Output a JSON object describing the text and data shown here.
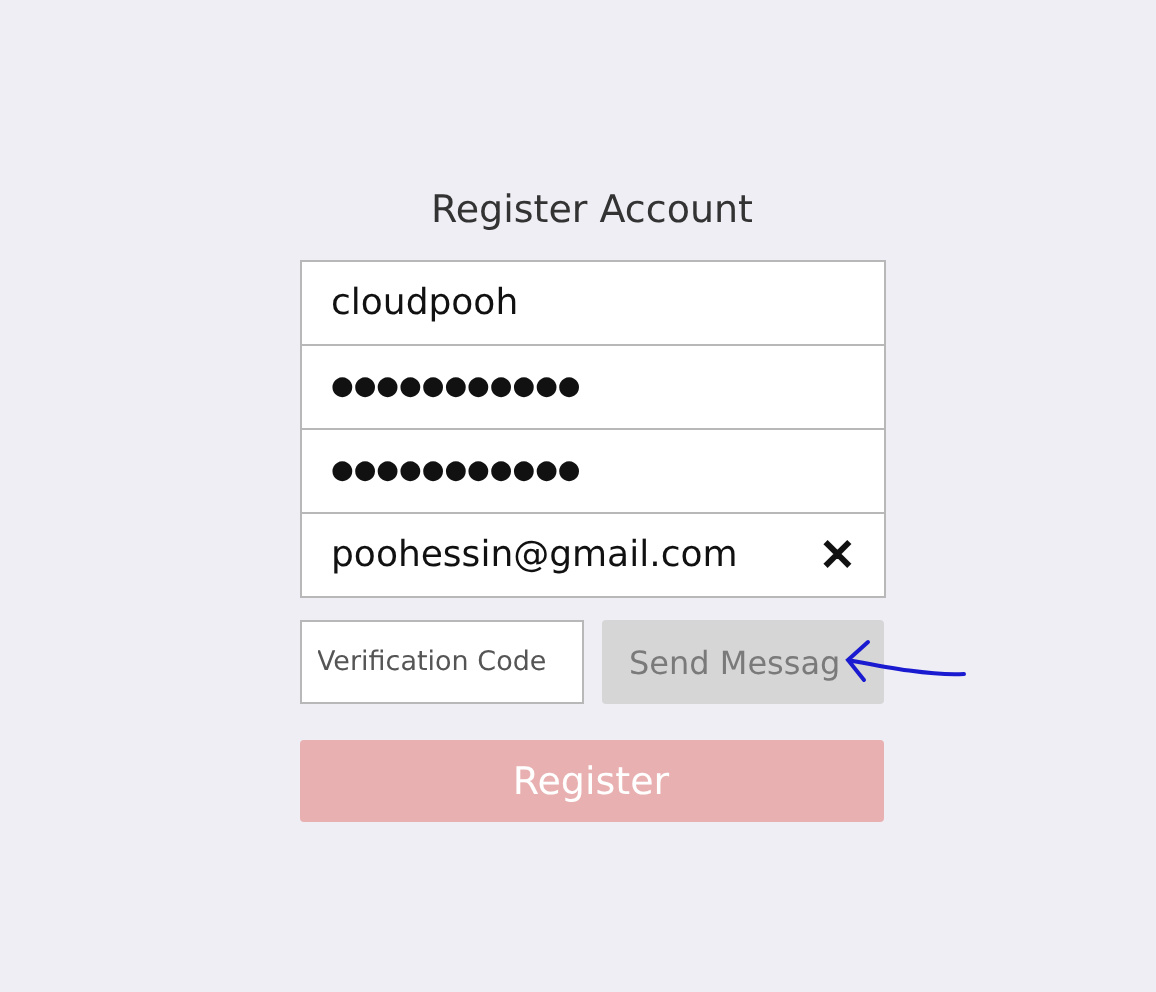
{
  "title": "Register Account",
  "fields": [
    {
      "kind": "text",
      "value": "cloudpooh"
    },
    {
      "kind": "password",
      "value": "●●●●●●●●●●●"
    },
    {
      "kind": "password",
      "value": "●●●●●●●●●●●"
    },
    {
      "kind": "clearable",
      "value": "poohessin@gmail.com",
      "clear": "✕"
    }
  ],
  "verification": {
    "placeholder": "Verification Code"
  },
  "send_button": {
    "label": "Send Messag",
    "disabled": true
  },
  "register_button": {
    "label": "Register",
    "disabled": true
  }
}
